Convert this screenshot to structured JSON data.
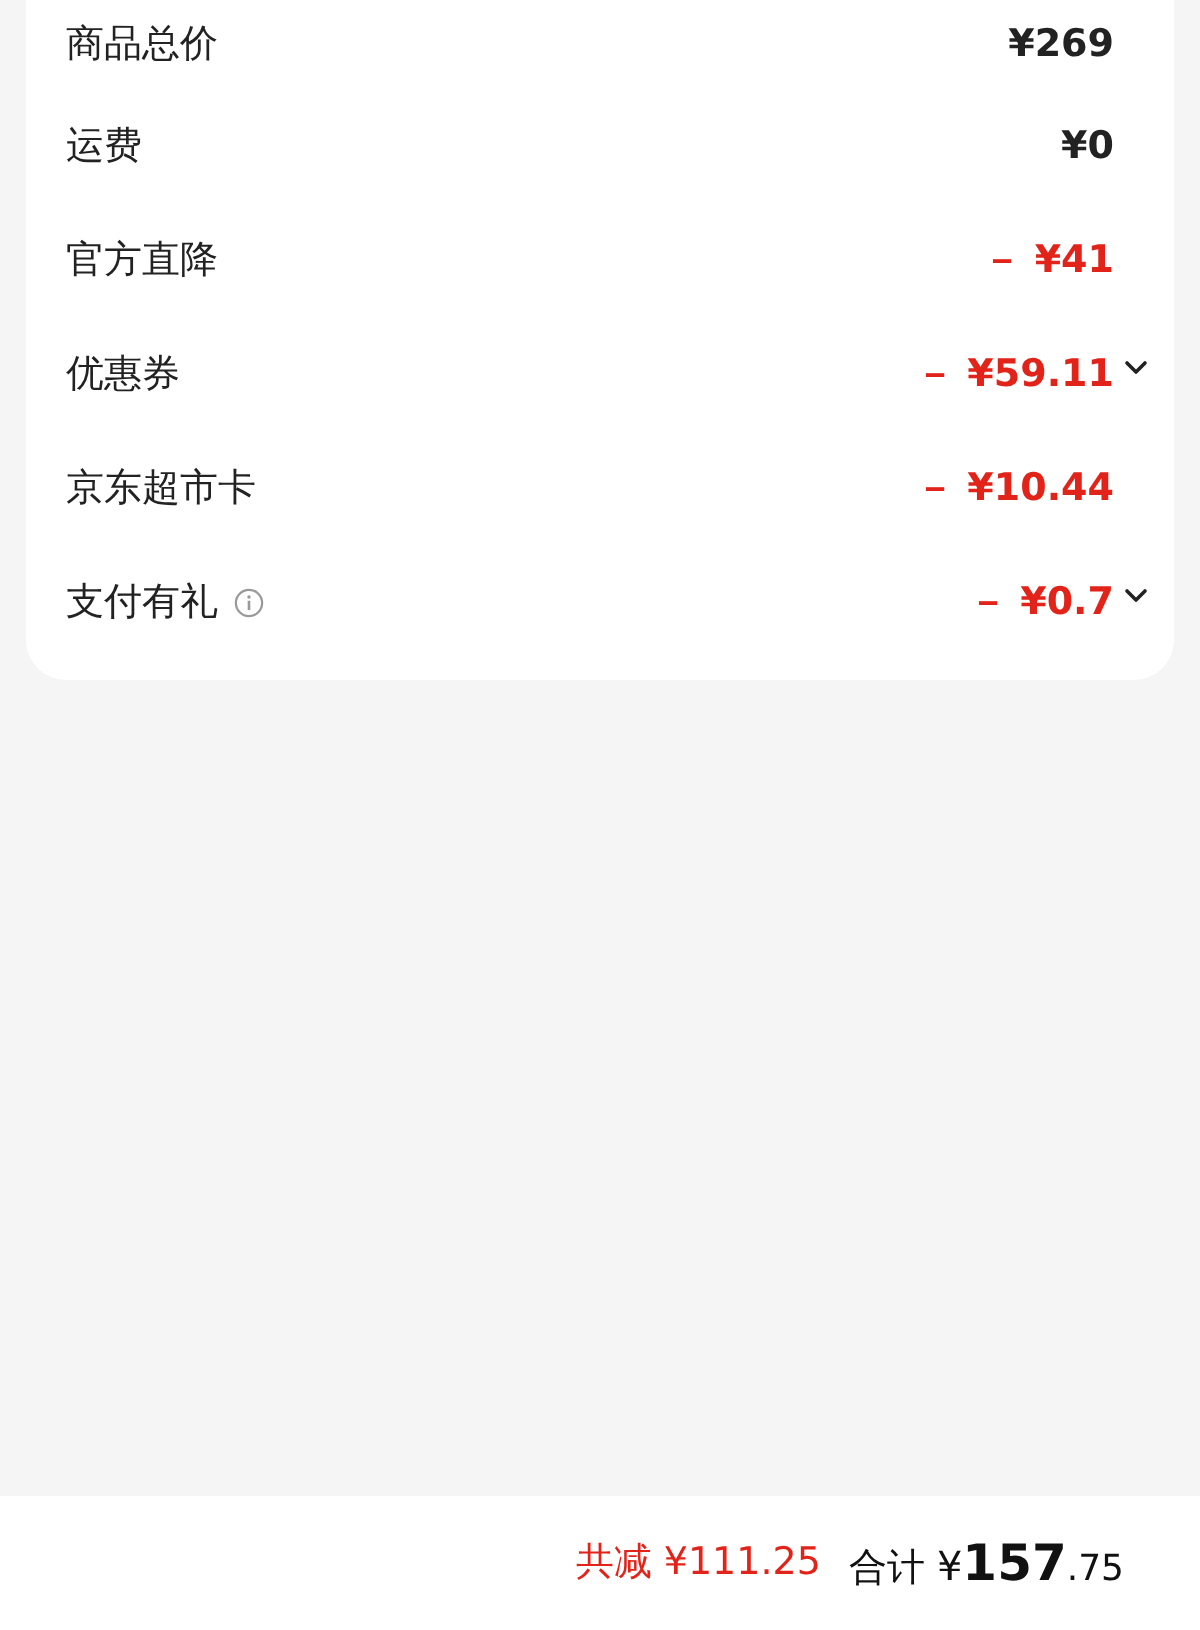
{
  "price_rows": [
    {
      "label": "商品总价",
      "value": "¥269",
      "discount": false,
      "info": false,
      "expandable": false
    },
    {
      "label": "运费",
      "value": "¥0",
      "discount": false,
      "info": false,
      "expandable": false
    },
    {
      "label": "官方直降",
      "value": "－ ¥41",
      "discount": true,
      "info": false,
      "expandable": false
    },
    {
      "label": "优惠券",
      "value": "－ ¥59.11",
      "discount": true,
      "info": false,
      "expandable": true
    },
    {
      "label": "京东超市卡",
      "value": "－ ¥10.44",
      "discount": true,
      "info": false,
      "expandable": false
    },
    {
      "label": "支付有礼",
      "value": "－ ¥0.7",
      "discount": true,
      "info": true,
      "expandable": true
    }
  ],
  "footer": {
    "saved_label": "共减",
    "saved_amount": "¥111.25",
    "total_label": "合计",
    "total_currency": "¥",
    "total_integer": "157",
    "total_decimal": ".75"
  }
}
